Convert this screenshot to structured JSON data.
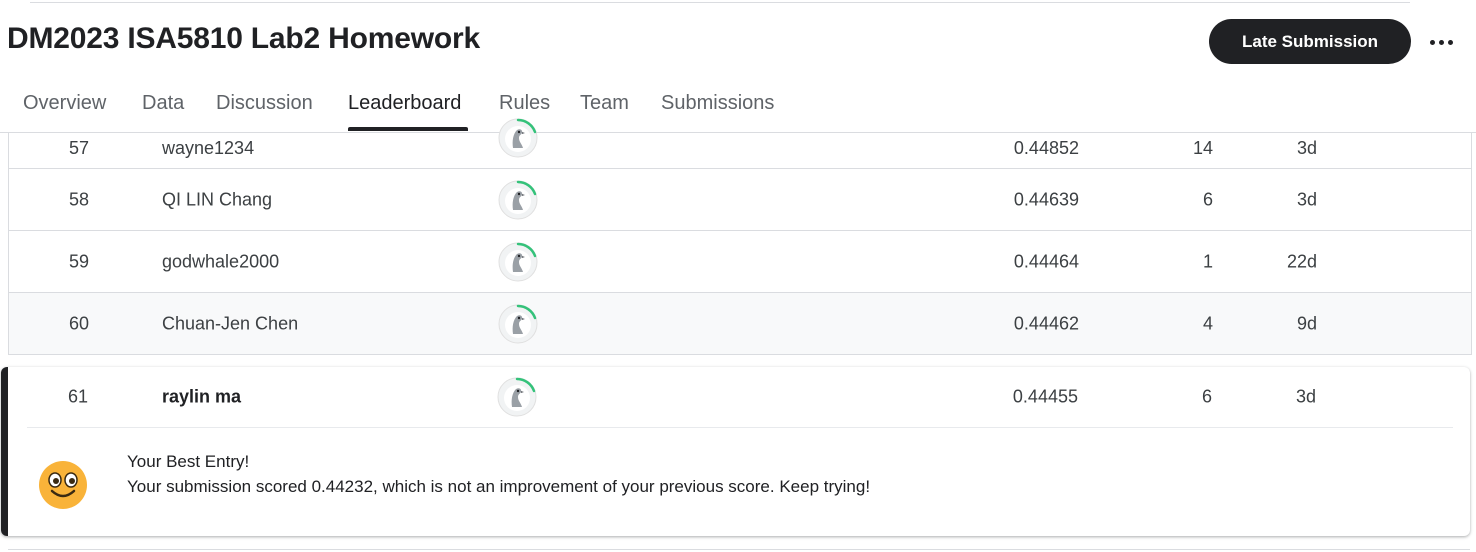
{
  "page": {
    "title": "DM2023 ISA5810 Lab2 Homework",
    "late_submission_label": "Late Submission",
    "more_options_icon": "more-horizontal-icon"
  },
  "tabs": [
    {
      "label": "Overview"
    },
    {
      "label": "Data"
    },
    {
      "label": "Discussion"
    },
    {
      "label": "Leaderboard",
      "active": true
    },
    {
      "label": "Rules"
    },
    {
      "label": "Team"
    },
    {
      "label": "Submissions"
    }
  ],
  "leaderboard": {
    "rows": [
      {
        "rank": "57",
        "team": "wayne1234",
        "score": "0.44852",
        "entries": "14",
        "last": "3d"
      },
      {
        "rank": "58",
        "team": "QI LIN Chang",
        "score": "0.44639",
        "entries": "6",
        "last": "3d"
      },
      {
        "rank": "59",
        "team": "godwhale2000",
        "score": "0.44464",
        "entries": "1",
        "last": "22d"
      },
      {
        "rank": "60",
        "team": "Chuan-Jen Chen",
        "score": "0.44462",
        "entries": "4",
        "last": "9d"
      }
    ],
    "my_entry": {
      "rank": "61",
      "team": "raylin ma",
      "score": "0.44455",
      "entries": "6",
      "last": "3d"
    }
  },
  "message": {
    "icon": "smiley-face-icon",
    "title": "Your Best Entry!",
    "body": "Your submission scored 0.44232, which is not an improvement of your previous score. Keep trying!"
  },
  "colors": {
    "progress_ring": "#20BEFF",
    "progress_green": "#34c27a",
    "accent_bar": "#202124",
    "emoji_yellow": "#f9b339"
  }
}
